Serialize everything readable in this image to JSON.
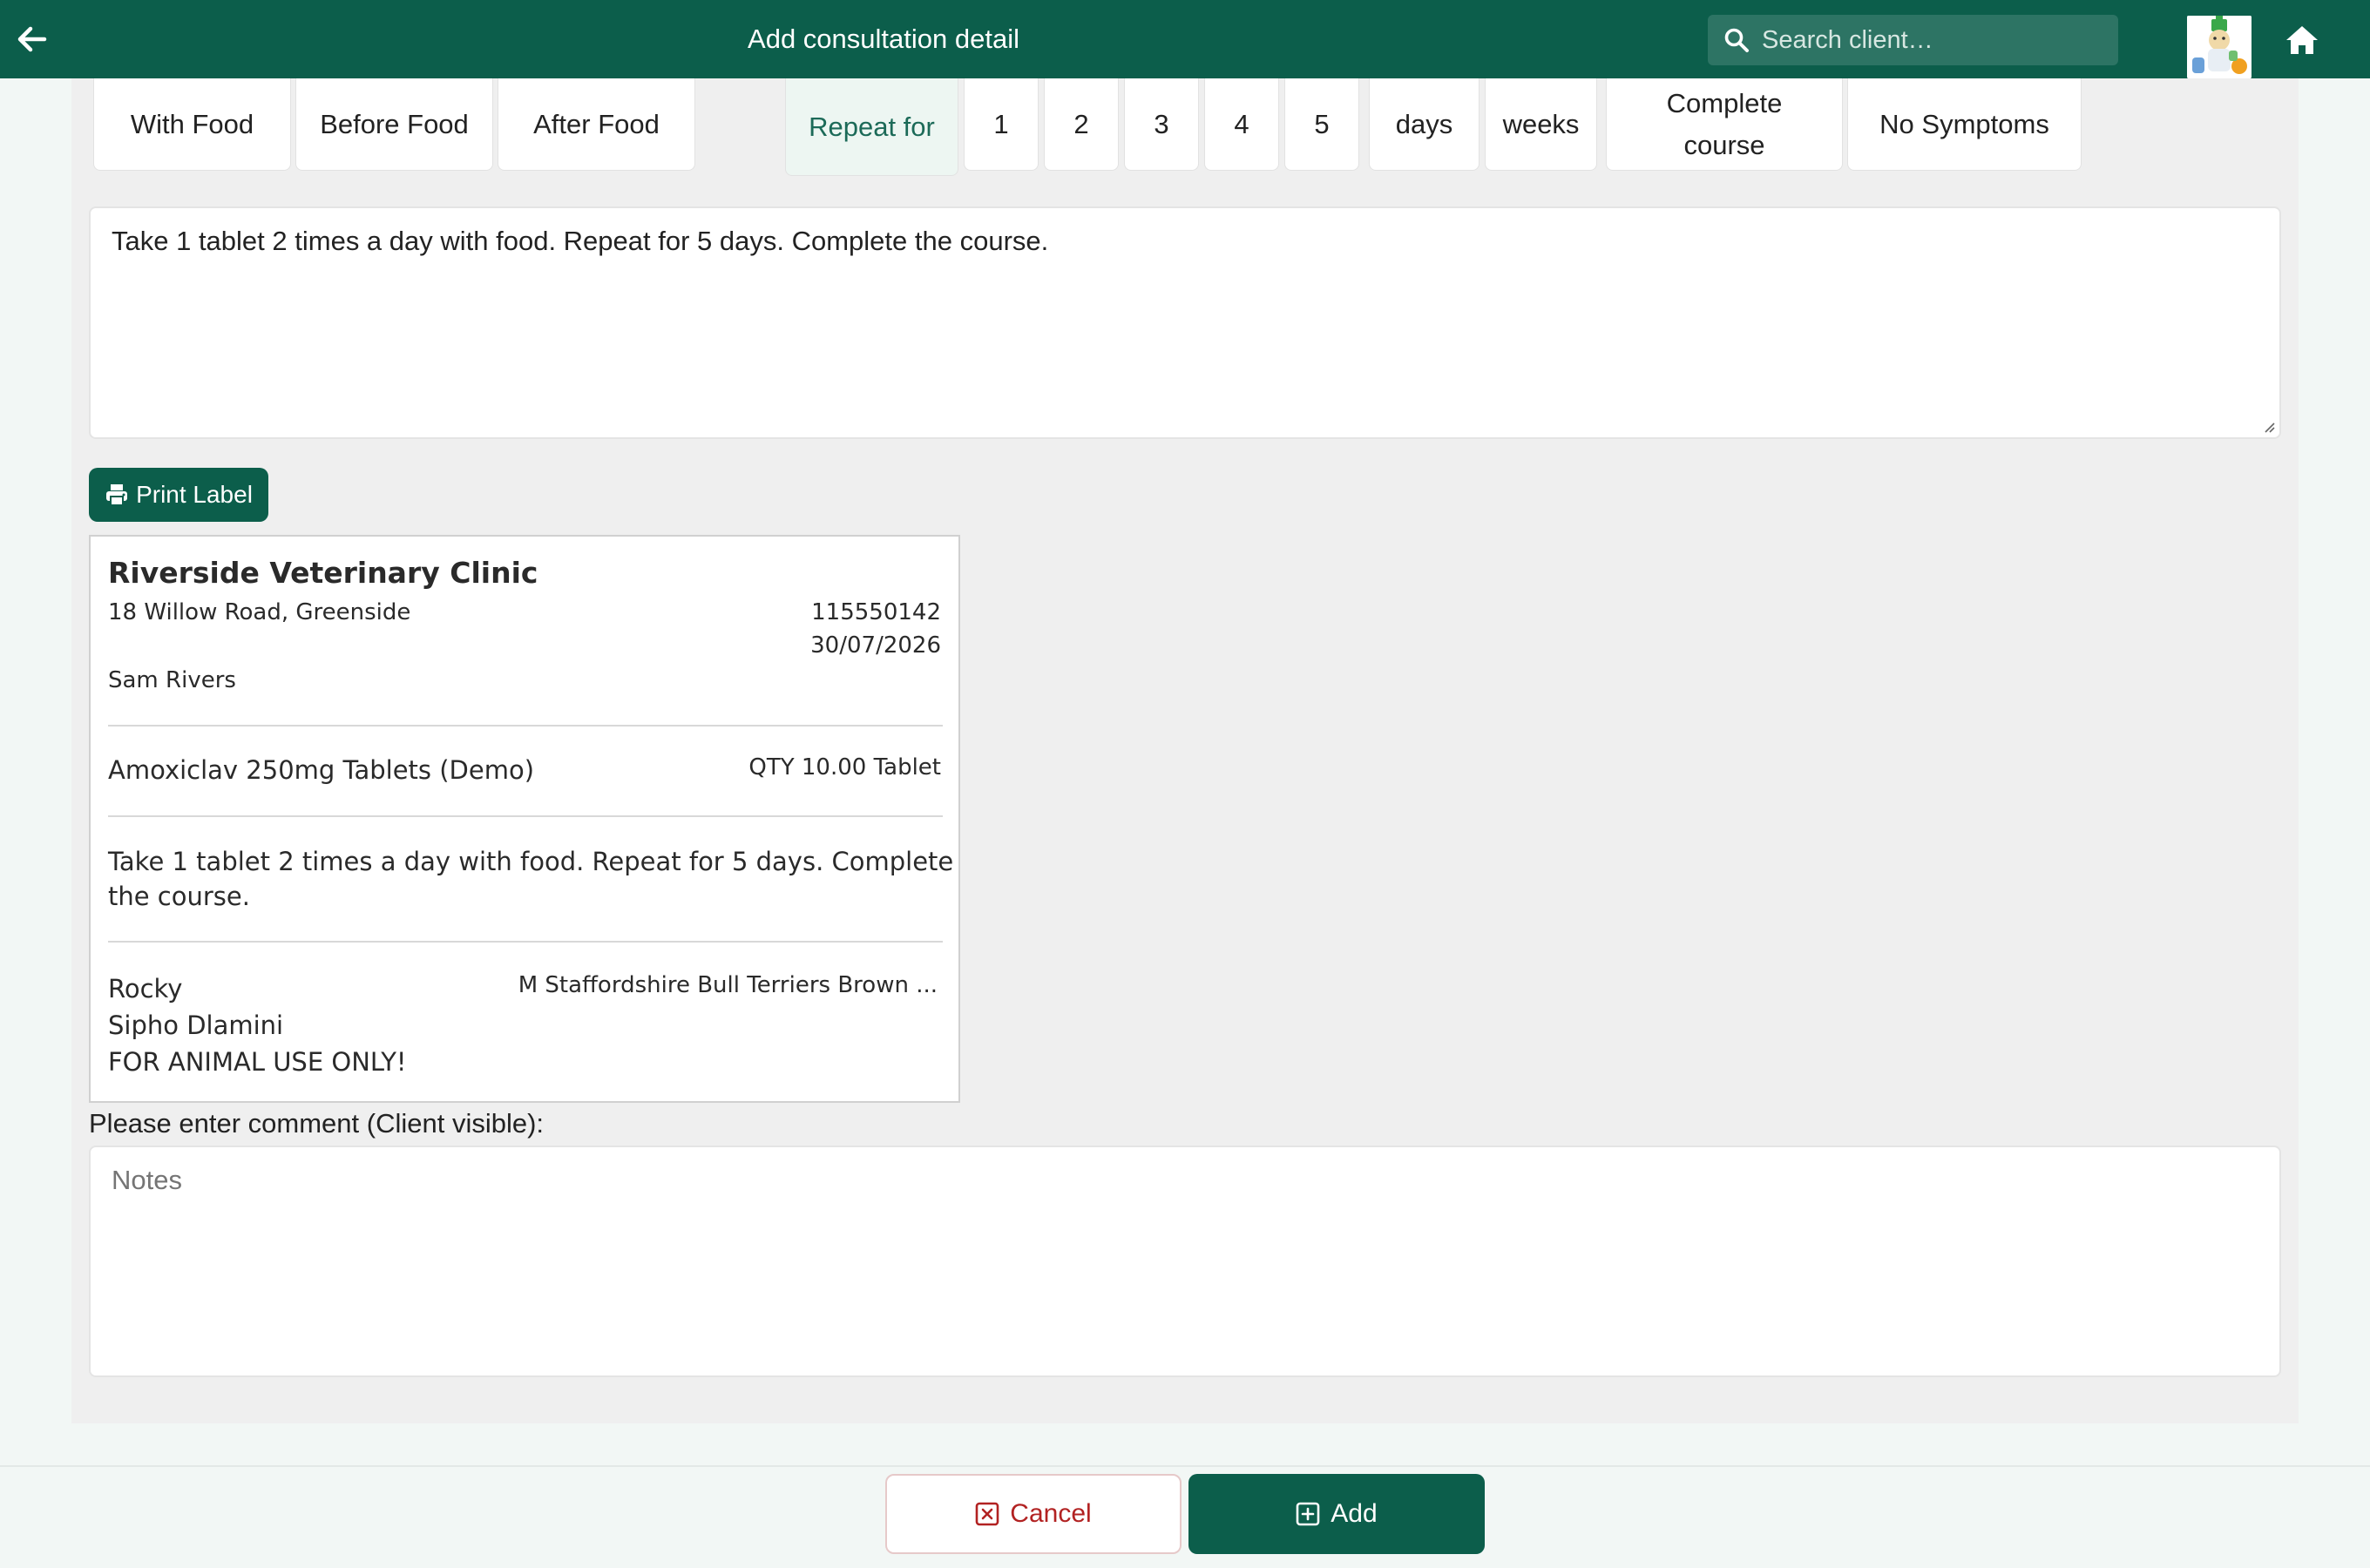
{
  "header": {
    "title": "Add consultation detail",
    "search_placeholder": "Search client…"
  },
  "instruction_chips": {
    "food": [
      "With Food",
      "Before Food",
      "After Food"
    ],
    "repeat_label": "Repeat for",
    "numbers": [
      "1",
      "2",
      "3",
      "4",
      "5"
    ],
    "units": [
      "days",
      "weeks"
    ],
    "complete_line1": "Complete",
    "complete_line2": "course",
    "no_symptoms": "No Symptoms"
  },
  "instructions_text": "Take 1 tablet 2 times a day with food. Repeat for 5 days. Complete the course.",
  "print_label_button": "Print Label",
  "label_preview": {
    "clinic_name": "Riverside Veterinary Clinic",
    "clinic_address": "18 Willow Road, Greenside",
    "phone": "115550142",
    "date": "30/07/2026",
    "vet": "Sam Rivers",
    "product": "Amoxiclav 250mg Tablets (Demo)",
    "quantity": "QTY 10.00 Tablet",
    "instructions_line1": "Take 1 tablet 2 times a day with food. Repeat for 5 days. Complete",
    "instructions_line2": "the course.",
    "patient": "Rocky",
    "patient_details": "M Staffordshire Bull Terriers Brown ...",
    "owner": "Sipho Dlamini",
    "disclaimer": "FOR ANIMAL USE ONLY!"
  },
  "comment": {
    "label": "Please enter comment (Client visible):",
    "placeholder": "Notes",
    "value": ""
  },
  "footer": {
    "cancel_label": "Cancel",
    "add_label": "Add"
  },
  "colors": {
    "primary": "#0c5e4b",
    "cancel": "#b22222",
    "panel_bg": "#efefef"
  }
}
